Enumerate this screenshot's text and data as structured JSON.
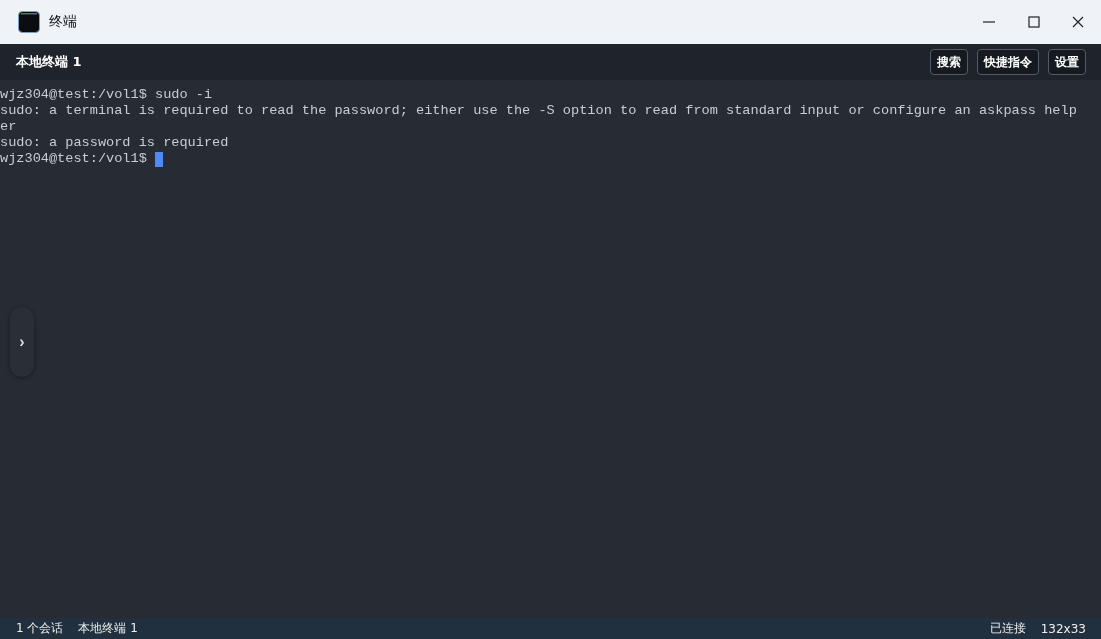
{
  "window": {
    "title": "终端"
  },
  "tab": {
    "label": "本地终端 1"
  },
  "toolbar": [
    "搜索",
    "快捷指令",
    "设置"
  ],
  "side_toggle": "›",
  "terminal": {
    "lines": [
      "wjz304@test:/vol1$ sudo -i",
      "sudo: a terminal is required to read the password; either use the -S option to read from standard input or configure an askpass help",
      "er",
      "sudo: a password is required"
    ],
    "prompt": "wjz304@test:/vol1$ "
  },
  "status_bar": {
    "left": [
      "1 个会话",
      "本地终端 1"
    ],
    "right": [
      "已连接",
      "132x33"
    ]
  }
}
